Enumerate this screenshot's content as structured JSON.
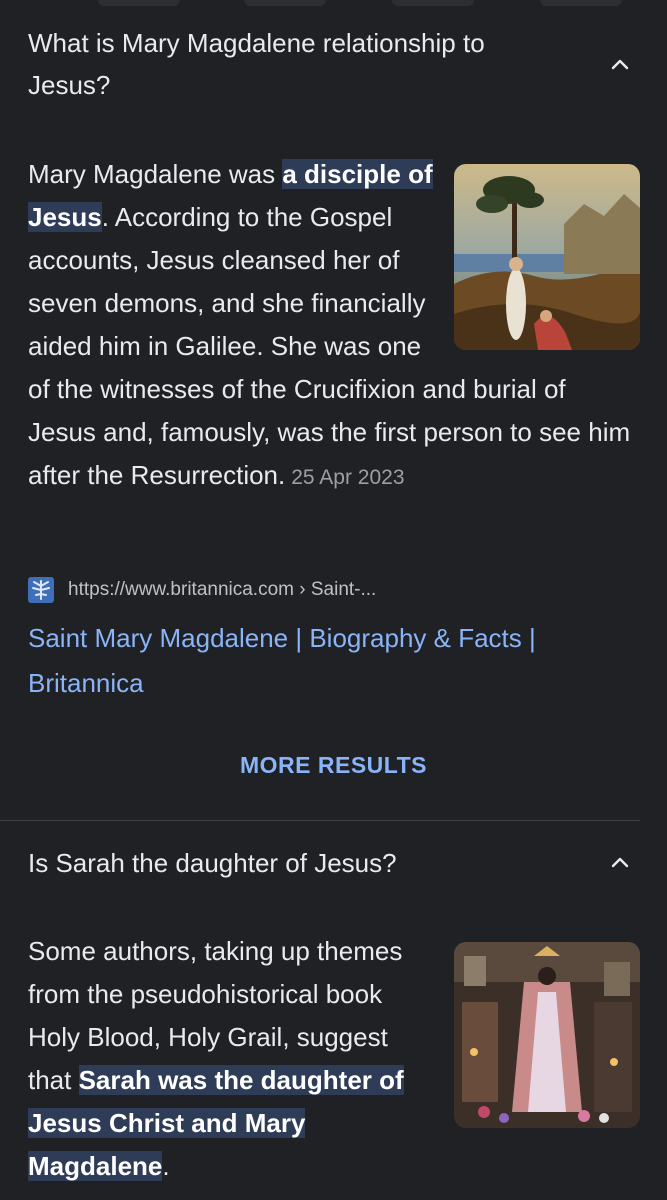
{
  "faq": [
    {
      "question": "What is Mary Magdalene relationship to Jesus?",
      "answer": {
        "before": "Mary Magdalene was ",
        "highlight": "a disciple of Jesus",
        "after": ". According to the Gospel accounts, Jesus cleansed her of seven demons, and she financially aided him in Galilee. She was one of the witnesses of the Crucifixion and burial of Jesus and, famously, was the first person to see him after the Resurrection.",
        "date": "25 Apr 2023"
      },
      "image_icon": "noli-me-tangere-painting",
      "source": {
        "favicon_icon": "britannica-thistle-icon",
        "url": "https://www.britannica.com › Saint-...",
        "title": "Saint Mary Magdalene | Biography & Facts | Britannica"
      },
      "expanded": true
    },
    {
      "question": "Is Sarah the daughter of Jesus?",
      "answer": {
        "before": "Some authors, taking up themes from the pseudohistorical book Holy Blood, Holy Grail, suggest that ",
        "highlight": "Sarah was the daughter of Jesus Christ and Mary Magdalene",
        "after": "."
      },
      "image_icon": "saint-sarah-shrine-photo",
      "expanded": true
    }
  ],
  "more_results_label": "MORE RESULTS",
  "colors": {
    "background": "#202124",
    "text": "#e8eaed",
    "link": "#8ab4f8",
    "highlight_bg": "#2f3c57",
    "secondary": "#9aa0a6",
    "divider": "#3c4043"
  }
}
